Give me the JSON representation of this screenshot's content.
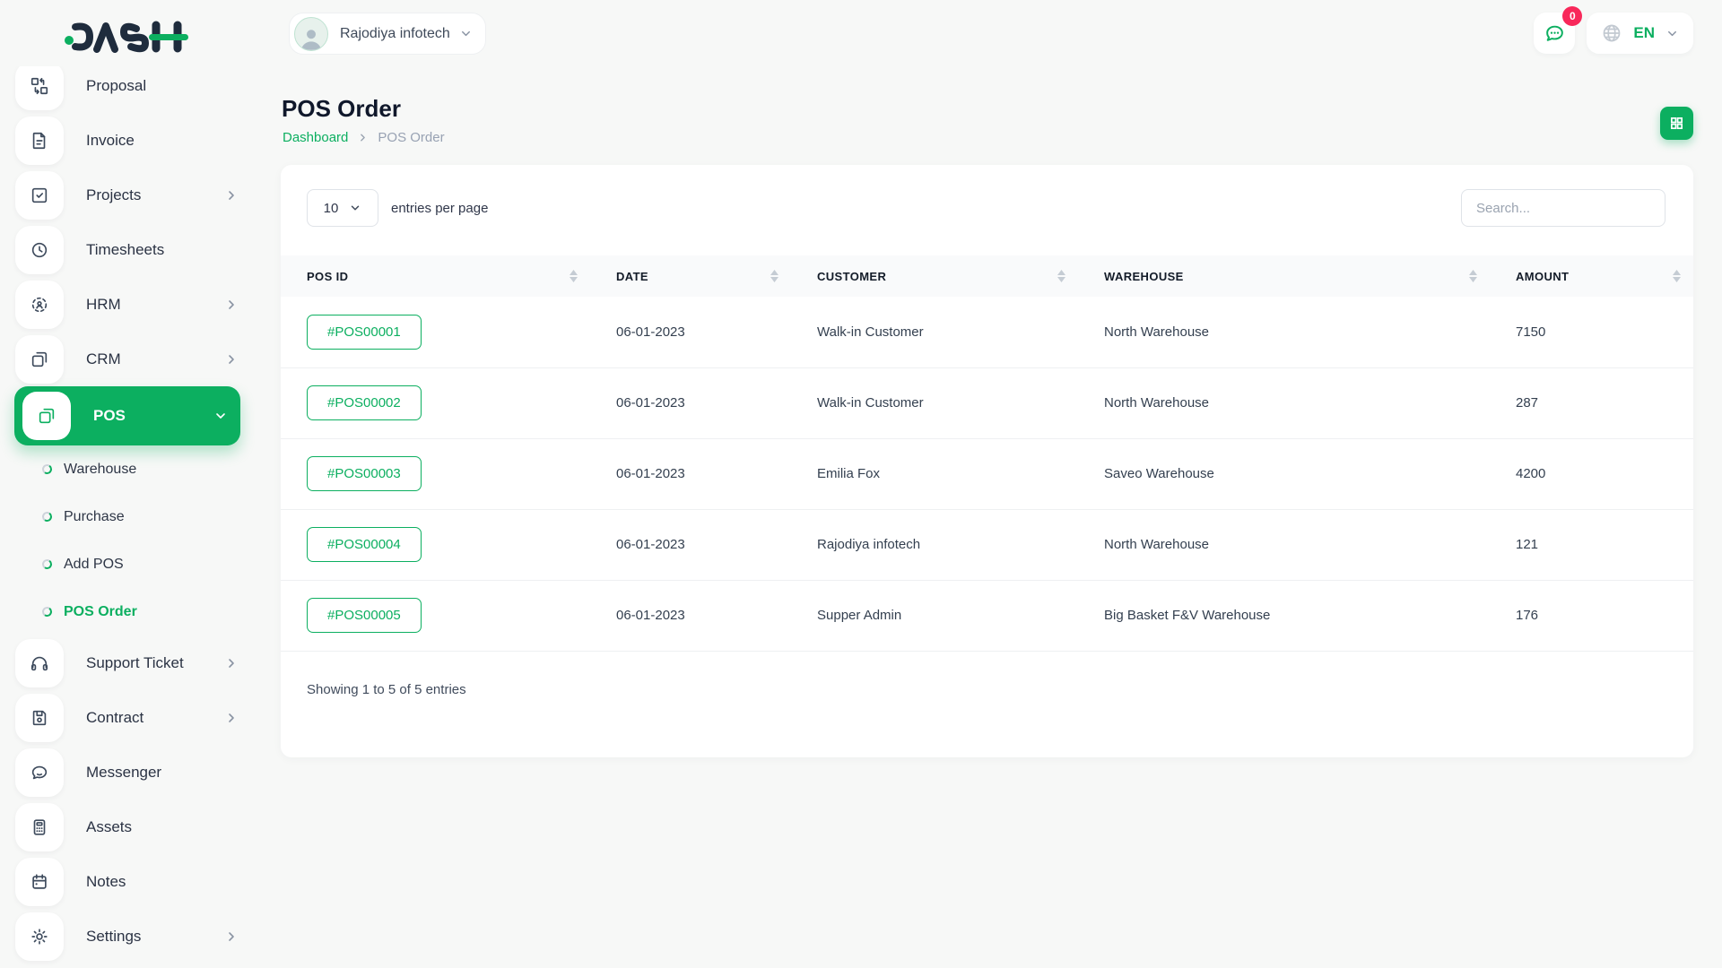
{
  "brand": {
    "name": "DASH"
  },
  "topbar": {
    "workspace_name": "Rajodiya infotech",
    "chat_badge_count": "0",
    "language_code": "EN"
  },
  "sidebar": {
    "items": [
      {
        "label": "Proposal"
      },
      {
        "label": "Invoice"
      },
      {
        "label": "Projects"
      },
      {
        "label": "Timesheets"
      },
      {
        "label": "HRM"
      },
      {
        "label": "CRM"
      },
      {
        "label": "POS"
      },
      {
        "label": "Support Ticket"
      },
      {
        "label": "Contract"
      },
      {
        "label": "Messenger"
      },
      {
        "label": "Assets"
      },
      {
        "label": "Notes"
      },
      {
        "label": "Settings"
      }
    ],
    "pos_subitems": [
      {
        "label": "Warehouse"
      },
      {
        "label": "Purchase"
      },
      {
        "label": "Add POS"
      },
      {
        "label": "POS Order"
      }
    ]
  },
  "page": {
    "title": "POS Order",
    "breadcrumb_home": "Dashboard",
    "breadcrumb_current": "POS Order"
  },
  "table_controls": {
    "page_size": "10",
    "entries_label": "entries per page",
    "search_placeholder": "Search..."
  },
  "table": {
    "columns": [
      "POS ID",
      "DATE",
      "CUSTOMER",
      "WAREHOUSE",
      "AMOUNT"
    ],
    "rows": [
      {
        "pos_id": "#POS00001",
        "date": "06-01-2023",
        "customer": "Walk-in Customer",
        "warehouse": "North Warehouse",
        "amount": "7150"
      },
      {
        "pos_id": "#POS00002",
        "date": "06-01-2023",
        "customer": "Walk-in Customer",
        "warehouse": "North Warehouse",
        "amount": "287"
      },
      {
        "pos_id": "#POS00003",
        "date": "06-01-2023",
        "customer": "Emilia Fox",
        "warehouse": "Saveo Warehouse",
        "amount": "4200"
      },
      {
        "pos_id": "#POS00004",
        "date": "06-01-2023",
        "customer": "Rajodiya infotech",
        "warehouse": "North Warehouse",
        "amount": "121"
      },
      {
        "pos_id": "#POS00005",
        "date": "06-01-2023",
        "customer": "Supper Admin",
        "warehouse": "Big Basket F&V Warehouse",
        "amount": "176"
      }
    ],
    "footer_text": "Showing 1 to 5 of 5 entries"
  },
  "colors": {
    "accent_green": "#0CAF60",
    "badge_pink": "#F8285A",
    "logo_navy": "#1f2c3d"
  }
}
